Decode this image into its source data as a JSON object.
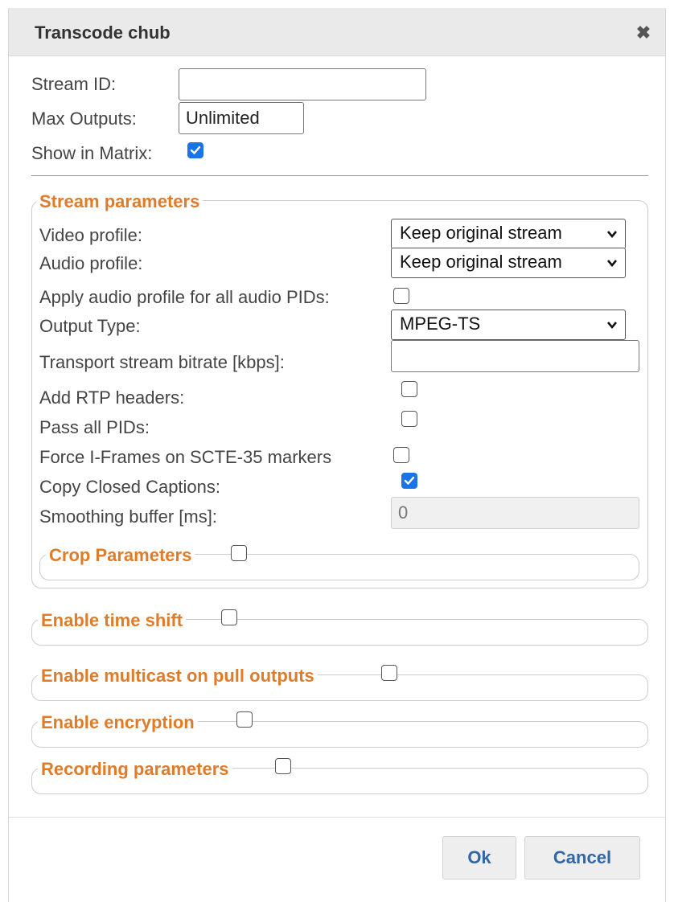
{
  "dialog": {
    "title": "Transcode chub",
    "close_icon": "close-icon"
  },
  "general": {
    "stream_id_label": "Stream ID:",
    "stream_id_value": "",
    "max_outputs_label": "Max Outputs:",
    "max_outputs_value": "Unlimited",
    "show_in_matrix_label": "Show in Matrix:",
    "show_in_matrix_checked": true
  },
  "stream_parameters": {
    "legend": "Stream parameters",
    "video_profile_label": "Video profile:",
    "video_profile_value": "Keep original stream",
    "audio_profile_label": "Audio profile:",
    "audio_profile_value": "Keep original stream",
    "apply_audio_label": "Apply audio profile for all audio PIDs:",
    "apply_audio_checked": false,
    "output_type_label": "Output Type:",
    "output_type_value": "MPEG-TS",
    "ts_bitrate_label": "Transport stream bitrate [kbps]:",
    "ts_bitrate_value": "",
    "rtp_headers_label": "Add RTP headers:",
    "rtp_headers_checked": false,
    "pass_pids_label": "Pass all PIDs:",
    "pass_pids_checked": false,
    "force_iframes_label": "Force I-Frames on SCTE-35 markers",
    "force_iframes_checked": false,
    "closed_captions_label": "Copy Closed Captions:",
    "closed_captions_checked": true,
    "smoothing_label": "Smoothing buffer [ms]:",
    "smoothing_value": "0",
    "crop_legend": "Crop Parameters",
    "crop_checked": false
  },
  "sections": {
    "time_shift": "Enable time shift",
    "multicast": "Enable multicast on pull outputs",
    "encryption": "Enable encryption",
    "recording": "Recording parameters"
  },
  "buttons": {
    "ok": "Ok",
    "cancel": "Cancel"
  },
  "colors": {
    "accent": "#e07b28",
    "checkbox_checked": "#1a73e8",
    "button_text": "#2f67a8"
  }
}
